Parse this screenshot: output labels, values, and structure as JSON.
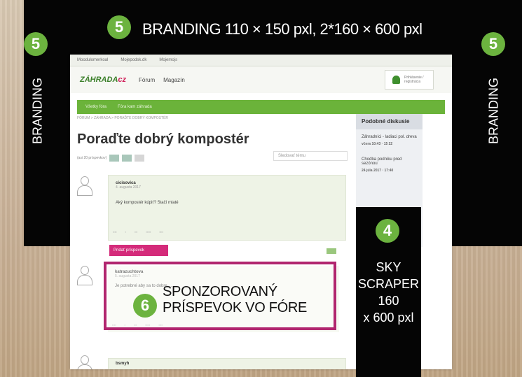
{
  "labels": {
    "top_badge": "5",
    "top_text": "BRANDING 110 × 150 pxl, 2*160 × 600 pxl",
    "left_badge": "5",
    "left_text": "BRANDING",
    "right_badge": "5",
    "right_text": "BRANDING",
    "sky_badge": "4",
    "sky_lines": [
      "SKY",
      "SCRAPER",
      "160",
      "x 600 pxl"
    ],
    "sponsor_badge": "6",
    "sponsor_line1": "SPONZOROVANÝ",
    "sponsor_line2": "PRÍSPEVOK VO FÓRE"
  },
  "site": {
    "topbar": [
      "Moodulomerkoal",
      "Mojepodsk.dk",
      "Mojemojs"
    ],
    "logo": "ZÁHRADA",
    "logo_suffix": "cz",
    "nav": [
      "Fórum",
      "Magazín"
    ],
    "user": "Prihlásenie / registrácia",
    "greenbar": [
      "Všetky fóra",
      "Fóra kam záhrada"
    ],
    "breadcrumb": "FÓRUM > ZÁHRADA > PORAĎTE DOBRÝ KOMPOSTÉR",
    "title": "Poraďte dobrý kompostér",
    "pager_label": "(asi 20 príspevkov)",
    "pages": [
      "1",
      "2",
      "3"
    ],
    "watch": "Sledovať tému",
    "sidebar": {
      "title": "Podobné diskusie",
      "items": [
        {
          "text": "Záhradníci - ladiaci pol. dreva",
          "date": "včera 10:43 · 15 22"
        },
        {
          "text": "Chodba podniku pred sezónou",
          "date": "24 júla 2017 · 17:40"
        }
      ]
    },
    "posts": [
      {
        "name": "cicisovica",
        "date": "4. augusta 2017",
        "text": "Aký kompostér kúpiť? Stačí mlaté"
      },
      {
        "name": "katrazuchtova",
        "date": "5. augusta 2017",
        "text": "Je potrebné aby sa to dobre ..."
      },
      {
        "name": "bsmyh",
        "date": "",
        "text": ""
      }
    ],
    "add_post": "Pridať príspevok"
  },
  "colors": {
    "brand_green": "#6cb33f",
    "accent_pink": "#b1266f",
    "black": "#050505"
  }
}
